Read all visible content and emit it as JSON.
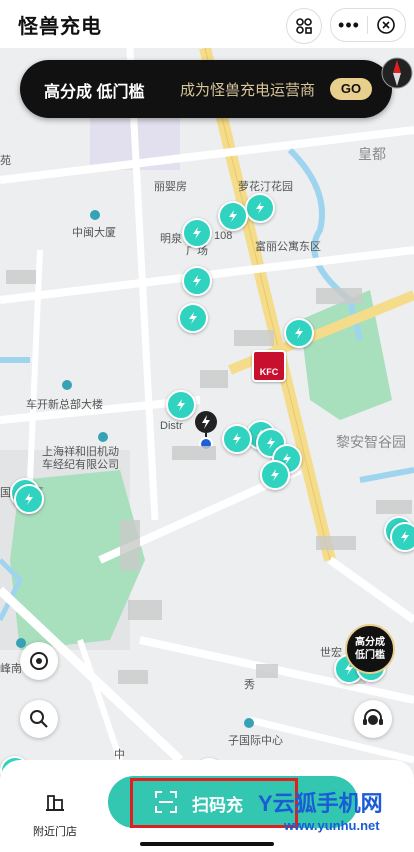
{
  "header": {
    "title": "怪兽充电"
  },
  "banner": {
    "main": "高分成 低门槛",
    "sub": "成为怪兽充电运营商",
    "go": "GO"
  },
  "map_labels": {
    "kuntong": "富丽公寓东区",
    "left_edge": "苑",
    "liyingdongwu": "丽婴房",
    "luohua": "萝花汀花园",
    "huangdu": "皇都",
    "zhongmin": "中闽大厦",
    "mingquan": "明泉",
    "road108": "108",
    "guangchang": "广场",
    "fuligongyu": "富丽公寓东区",
    "chekai": "车开新总部大楼",
    "district": "Distr",
    "xiangheji": "上海祥和旧机动\n车经纪有限公司",
    "guoji": "国际社区",
    "lianzhi": "黎安智谷园",
    "shihong": "世宏",
    "xiu": "秀",
    "feng": "峰南",
    "zhong": "中",
    "ziguoji": "子国际中心"
  },
  "promo_circle": "高分成\n低门槛",
  "bottom": {
    "nearby_label": "附近门店",
    "scan_label": "扫码充"
  },
  "watermark": {
    "big": "Y云狐手机网",
    "small": "www.yunhu.net"
  },
  "colors": {
    "accent": "#33c6b0",
    "marker": "#2fd3c0",
    "gold": "#e9cf8e"
  }
}
